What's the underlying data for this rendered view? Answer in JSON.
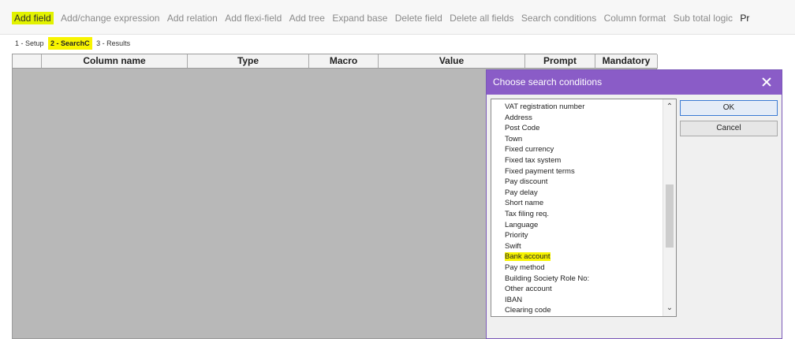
{
  "toolbar": {
    "items": [
      "Add field",
      "Add/change expression",
      "Add relation",
      "Add flexi-field",
      "Add tree",
      "Expand base",
      "Delete field",
      "Delete all fields",
      "Search conditions",
      "Column format",
      "Sub total logic",
      "Pr"
    ]
  },
  "tabs": [
    "1 - Setup",
    "2 - SearchC",
    "3 - Results"
  ],
  "grid": {
    "columns": [
      "",
      "Column name",
      "Type",
      "Macro",
      "Value",
      "Prompt",
      "Mandatory"
    ]
  },
  "dialog": {
    "title": "Choose search conditions",
    "close_icon": "close-icon",
    "ok_label": "OK",
    "cancel_label": "Cancel",
    "list_items": [
      "VAT registration number",
      "Address",
      "Post Code",
      "Town",
      "Fixed currency",
      "Fixed tax system",
      "Fixed payment terms",
      "Pay discount",
      "Pay delay",
      "Short name",
      "Tax filing req.",
      "Language",
      "Priority",
      "Swift",
      "Bank account",
      "Pay method",
      "Building Society Role No:",
      "Other account",
      "IBAN",
      "Clearing code"
    ],
    "scroll_up_glyph": "⌃",
    "scroll_down_glyph": "⌄"
  },
  "colors": {
    "highlight": "#f8f400",
    "dialog_title": "#8a5cc7"
  }
}
